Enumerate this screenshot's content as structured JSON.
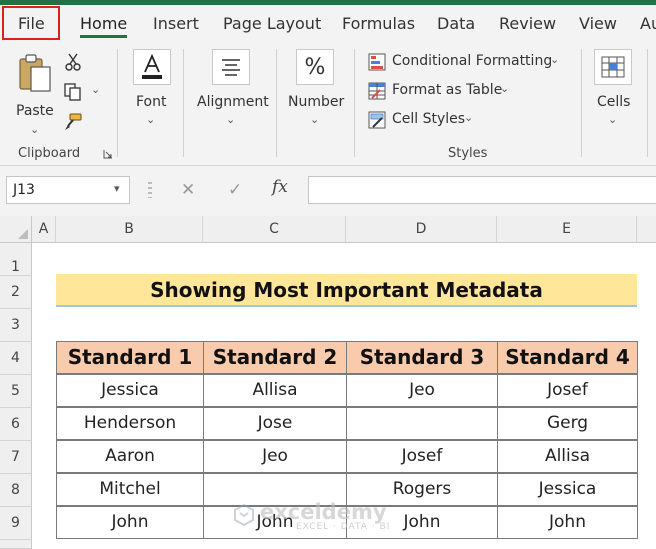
{
  "tabs": [
    {
      "label": "File"
    },
    {
      "label": "Home"
    },
    {
      "label": "Insert"
    },
    {
      "label": "Page Layout"
    },
    {
      "label": "Formulas"
    },
    {
      "label": "Data"
    },
    {
      "label": "Review"
    },
    {
      "label": "View"
    },
    {
      "label": "Au"
    }
  ],
  "ribbon": {
    "paste": "Paste",
    "clipboard": "Clipboard",
    "font": "Font",
    "alignment": "Alignment",
    "number": "Number",
    "number_symbol": "%",
    "conditional_formatting": "Conditional Formatting",
    "format_as_table": "Format as Table",
    "cell_styles": "Cell Styles",
    "styles": "Styles",
    "cells": "Cells"
  },
  "formula_bar": {
    "name_box": "J13",
    "fx": "fx",
    "value": ""
  },
  "grid": {
    "columns": [
      "A",
      "B",
      "C",
      "D",
      "E"
    ],
    "rows": [
      "1",
      "2",
      "3",
      "4",
      "5",
      "6",
      "7",
      "8",
      "9"
    ],
    "title": "Showing Most Important Metadata",
    "headers": [
      "Standard 1",
      "Standard 2",
      "Standard 3",
      "Standard 4"
    ],
    "data": [
      [
        "Jessica",
        "Allisa",
        "Jeo",
        "Josef"
      ],
      [
        "Henderson",
        "Jose",
        "",
        "Gerg"
      ],
      [
        "Aaron",
        "Jeo",
        "Josef",
        "Allisa"
      ],
      [
        "Mitchel",
        "",
        "Rogers",
        "Jessica"
      ],
      [
        "John",
        "John",
        "John",
        "John"
      ]
    ]
  },
  "watermark": {
    "name": "exceldemy",
    "tagline": "EXCEL · DATA · BI"
  },
  "colors": {
    "accent": "#217346",
    "title_fill": "#ffe699",
    "header_fill": "#f8cbad",
    "file_highlight": "#e02020"
  }
}
